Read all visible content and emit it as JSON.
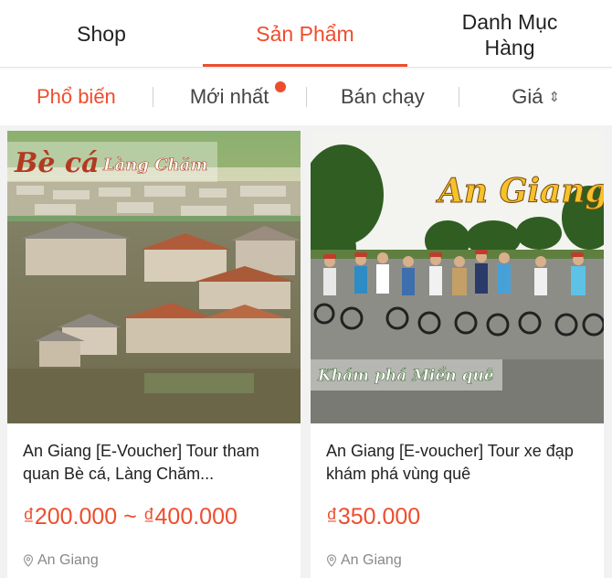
{
  "tabs": {
    "shop": "Shop",
    "products": "Sản Phẩm",
    "categories_line1": "Danh Mục",
    "categories_line2": "Hàng"
  },
  "sort": {
    "popular": "Phổ biến",
    "newest": "Mới nhất",
    "best_selling": "Bán chạy",
    "price": "Giá"
  },
  "products": [
    {
      "image_overlay_title": "Bè cá",
      "image_overlay_subtitle": "Làng Chăm",
      "name": "An Giang [E-Voucher] Tour tham quan Bè cá, Làng Chăm...",
      "price": "₫200.000 ~ ₫400.000",
      "location": "An Giang"
    },
    {
      "image_overlay_title": "An Giang",
      "image_overlay_subtitle": "Khám phá Miền quê",
      "name": "An Giang [E-voucher] Tour xe đạp khám phá vùng quê",
      "price": "₫350.000",
      "location": "An Giang"
    }
  ],
  "colors": {
    "accent": "#ee4d2d",
    "background": "#f2f2f2",
    "text": "#222222",
    "muted": "#888888"
  }
}
